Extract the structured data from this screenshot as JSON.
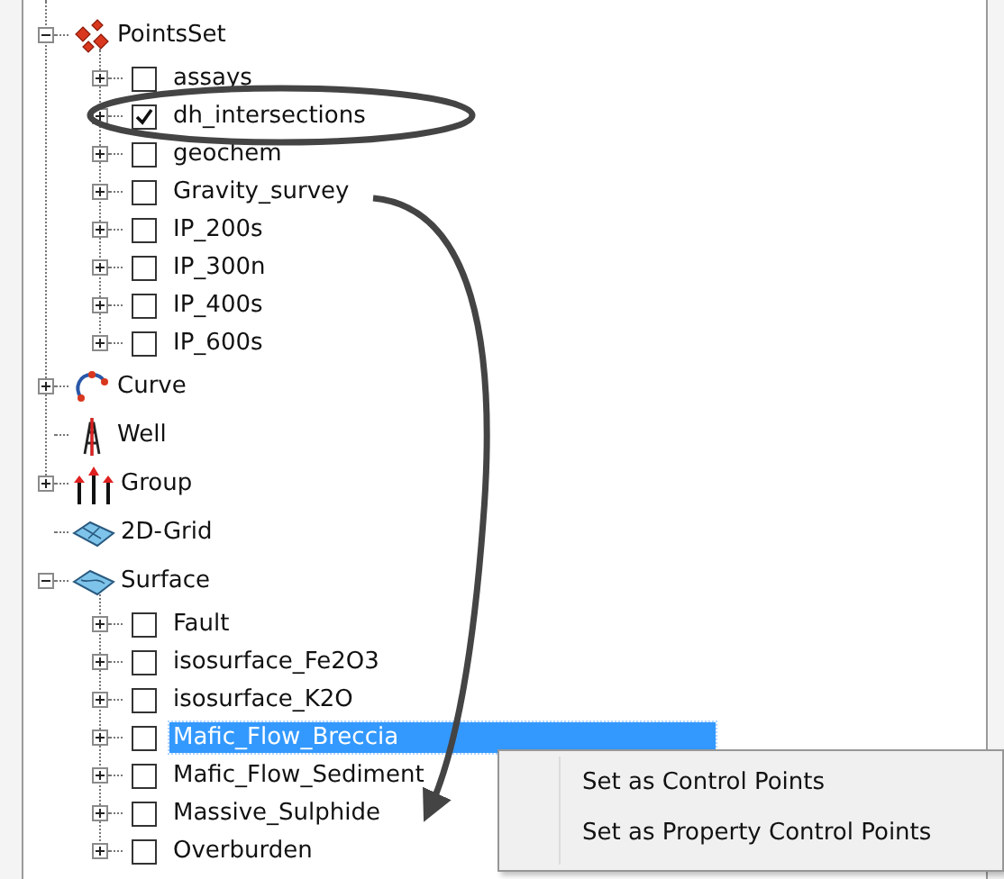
{
  "tree": [
    {
      "label": "PointsSet",
      "kind": "points",
      "expanded": true,
      "children": [
        {
          "label": "assays",
          "expanded": false,
          "checked": false,
          "selected": false
        },
        {
          "label": "dh_intersections",
          "expanded": false,
          "checked": true,
          "selected": false
        },
        {
          "label": "geochem",
          "expanded": false,
          "checked": false,
          "selected": false
        },
        {
          "label": "Gravity_survey",
          "expanded": false,
          "checked": false,
          "selected": false
        },
        {
          "label": "IP_200s",
          "expanded": false,
          "checked": false,
          "selected": false
        },
        {
          "label": "IP_300n",
          "expanded": false,
          "checked": false,
          "selected": false
        },
        {
          "label": "IP_400s",
          "expanded": false,
          "checked": false,
          "selected": false
        },
        {
          "label": "IP_600s",
          "expanded": false,
          "checked": false,
          "selected": false
        }
      ]
    },
    {
      "label": "Curve",
      "kind": "curve",
      "expanded": false
    },
    {
      "label": "Well",
      "kind": "well"
    },
    {
      "label": "Group",
      "kind": "group",
      "expanded": false
    },
    {
      "label": "2D-Grid",
      "kind": "grid"
    },
    {
      "label": "Surface",
      "kind": "surface",
      "expanded": true,
      "children": [
        {
          "label": "Fault",
          "expanded": false,
          "checked": false,
          "selected": false
        },
        {
          "label": "isosurface_Fe2O3",
          "expanded": false,
          "checked": false,
          "selected": false
        },
        {
          "label": "isosurface_K2O",
          "expanded": false,
          "checked": false,
          "selected": false
        },
        {
          "label": "Mafic_Flow_Breccia",
          "expanded": false,
          "checked": false,
          "selected": true
        },
        {
          "label": "Mafic_Flow_Sediment",
          "expanded": false,
          "checked": false,
          "selected": false
        },
        {
          "label": "Massive_Sulphide",
          "expanded": false,
          "checked": false,
          "selected": false
        },
        {
          "label": "Overburden",
          "expanded": false,
          "checked": false,
          "selected": false
        }
      ]
    }
  ],
  "context_menu": {
    "items": [
      "Set as Control Points",
      "Set as Property Control Points"
    ]
  }
}
